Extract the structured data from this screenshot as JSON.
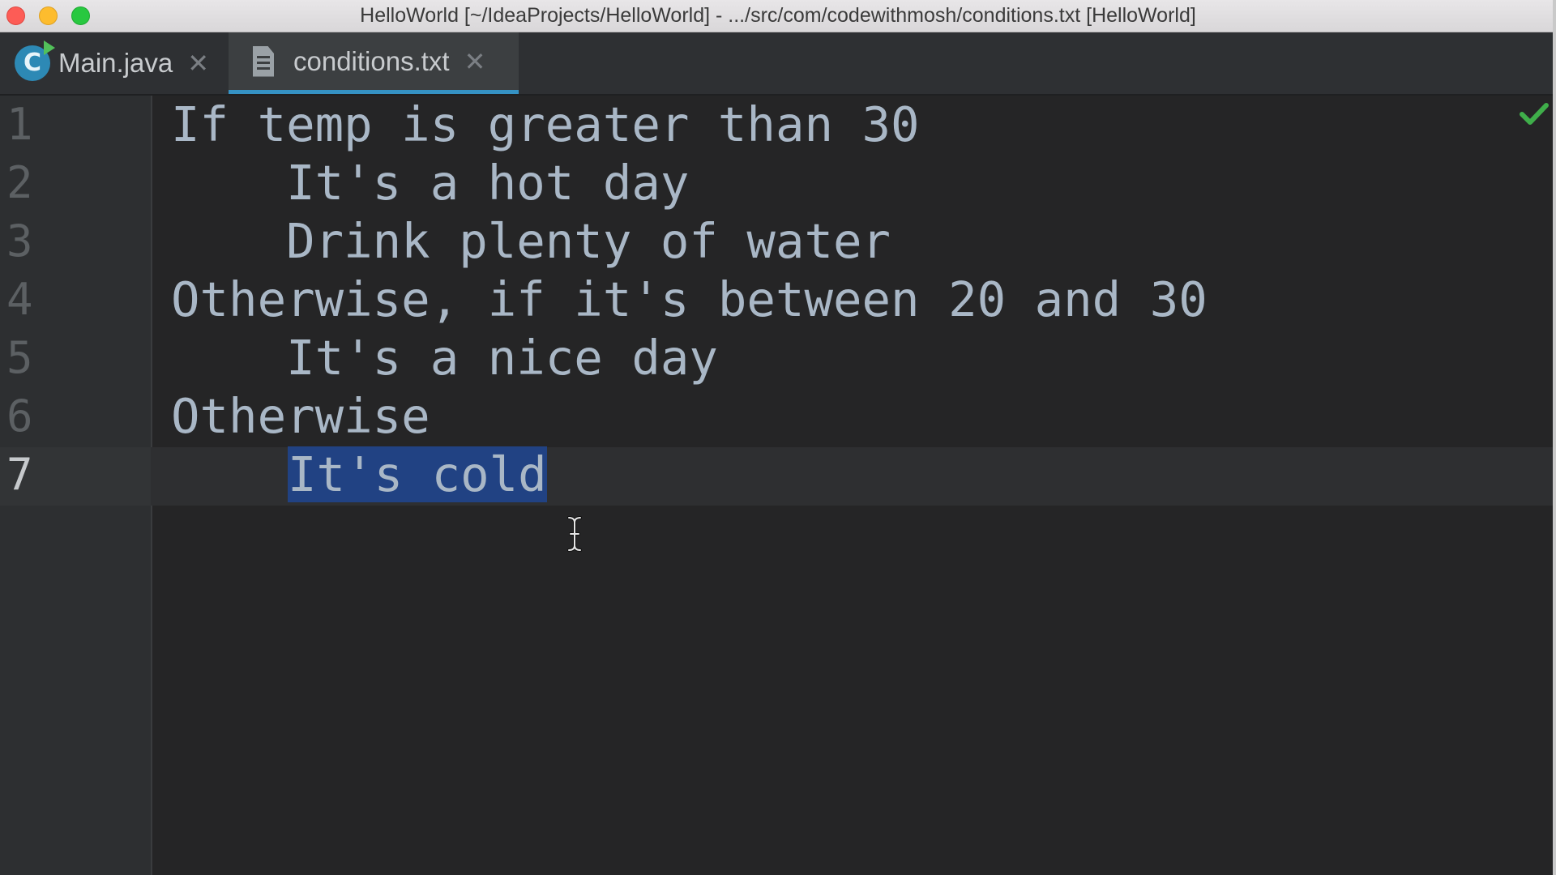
{
  "window": {
    "title": "HelloWorld [~/IdeaProjects/HelloWorld] - .../src/com/codewithmosh/conditions.txt [HelloWorld]"
  },
  "tabs": [
    {
      "label": "Main.java",
      "icon": "java-class-icon",
      "close": "✕",
      "active": false
    },
    {
      "label": "conditions.txt",
      "icon": "text-file-icon",
      "close": "✕",
      "active": true
    }
  ],
  "editor": {
    "status_icon": "checkmark-icon",
    "lines": [
      {
        "num": "1",
        "text": "If temp is greater than 30"
      },
      {
        "num": "2",
        "text": "    It's a hot day"
      },
      {
        "num": "3",
        "text": "    Drink plenty of water"
      },
      {
        "num": "4",
        "text": "Otherwise, if it's between 20 and 30"
      },
      {
        "num": "5",
        "text": "    It's a nice day"
      },
      {
        "num": "6",
        "text": "Otherwise"
      },
      {
        "num": "7",
        "text": "It's cold",
        "selected": true
      }
    ],
    "colors": {
      "text": "#a9b7c6",
      "selection": "#214283",
      "background": "#252526",
      "tab_underline": "#3592c4"
    }
  }
}
